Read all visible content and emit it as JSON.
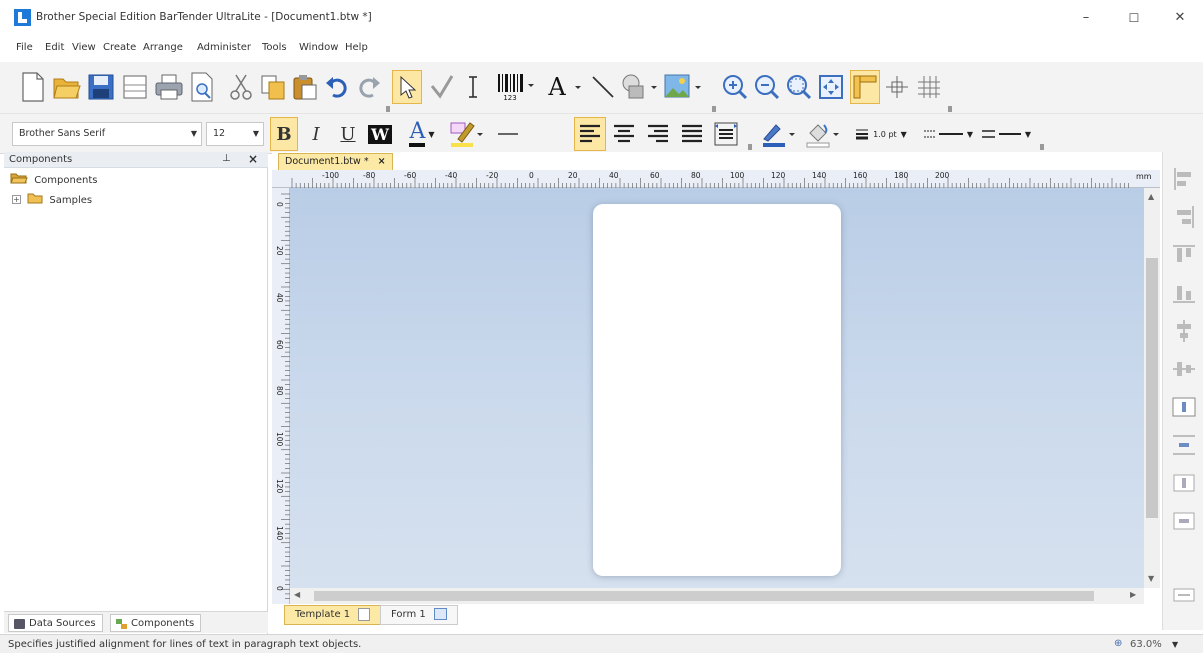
{
  "window": {
    "title": "Brother Special Edition BarTender UltraLite - [Document1.btw *]",
    "min_glyph": "–",
    "max_glyph": "☐",
    "close_glyph": "✕"
  },
  "menu": [
    "File",
    "Edit",
    "View",
    "Create",
    "Arrange",
    "Administer",
    "Tools",
    "Window",
    "Help"
  ],
  "format_toolbar": {
    "font_name": "Brother Sans Serif",
    "font_size": "12",
    "bold": "B",
    "italic": "I",
    "underline": "U",
    "reverse": "W",
    "font_color": "A",
    "line_weight": "1.0 pt"
  },
  "components_panel": {
    "title": "Components",
    "pin_glyph": "⊥",
    "close_glyph": "×",
    "tree": [
      {
        "label": "Components",
        "icon": "folder-open-icon"
      },
      {
        "label": "Samples",
        "icon": "folder-icon",
        "expander": "+"
      }
    ],
    "tabs": [
      "Data Sources",
      "Components"
    ]
  },
  "document": {
    "tab_label": "Document1.btw *",
    "tab_close": "×",
    "ruler_units": "mm",
    "ruler_h": [
      "-100",
      "-80",
      "-60",
      "-40",
      "-20",
      "0",
      "20",
      "40",
      "60",
      "80",
      "100",
      "120",
      "140",
      "160",
      "180",
      "200"
    ],
    "ruler_v": [
      "0",
      "20",
      "40",
      "60",
      "80",
      "100",
      "120",
      "140",
      "0"
    ],
    "bottom_tabs": [
      "Template 1",
      "Form 1"
    ]
  },
  "status": {
    "text": "Specifies justified alignment for lines of text in paragraph text objects.",
    "zoom": "63.0%"
  },
  "colors": {
    "selected": "#fde7a5",
    "canvas_top": "#b9cde6",
    "accent": "#1e7ad9"
  }
}
